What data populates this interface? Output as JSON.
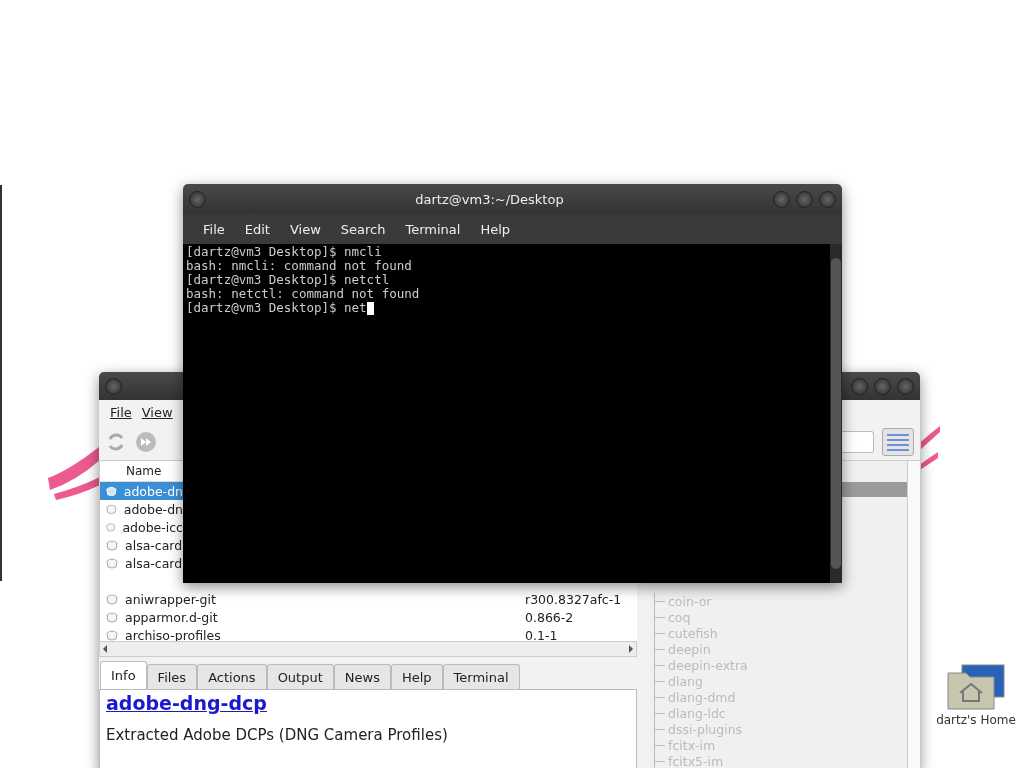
{
  "terminal": {
    "title": "dartz@vm3:~/Desktop",
    "menu": [
      "File",
      "Edit",
      "View",
      "Search",
      "Terminal",
      "Help"
    ],
    "lines": [
      "[dartz@vm3 Desktop]$ nmcli",
      "bash: nmcli: command not found",
      "[dartz@vm3 Desktop]$ netctl",
      "bash: netctl: command not found"
    ],
    "prompt": "[dartz@vm3 Desktop]$ net"
  },
  "package_manager": {
    "menu": [
      "File",
      "View"
    ],
    "list_header": "Name",
    "packages": [
      {
        "name": "adobe-dn",
        "selected": true
      },
      {
        "name": "adobe-dn",
        "selected": false
      },
      {
        "name": "adobe-icc",
        "selected": false
      },
      {
        "name": "alsa-card",
        "selected": false
      },
      {
        "name": "alsa-card",
        "selected": false
      },
      {
        "name": "aniwrapper-git",
        "version": "r300.8327afc-1",
        "selected": false
      },
      {
        "name": "apparmor.d-git",
        "version": "0.866-2",
        "selected": false
      },
      {
        "name": "archiso-profiles",
        "version": "0.1-1",
        "selected": false
      }
    ],
    "tabs": [
      {
        "label": "Info",
        "selected": true
      },
      {
        "label": "Files",
        "selected": false
      },
      {
        "label": "Actions",
        "selected": false
      },
      {
        "label": "Output",
        "selected": false
      },
      {
        "label": "News",
        "selected": false
      },
      {
        "label": "Help",
        "selected": false
      },
      {
        "label": "Terminal",
        "selected": false
      }
    ],
    "info": {
      "name": "adobe-dng-dcp",
      "description": "Extracted Adobe DCPs (DNG Camera Profiles)"
    },
    "groups": [
      "coin-or",
      "coq",
      "cutefish",
      "deepin",
      "deepin-extra",
      "dlang",
      "dlang-dmd",
      "dlang-ldc",
      "dssi-plugins",
      "fcitx-im",
      "fcitx5-im"
    ]
  },
  "desktop_icons": [
    {
      "label": "dartz's Home"
    }
  ]
}
